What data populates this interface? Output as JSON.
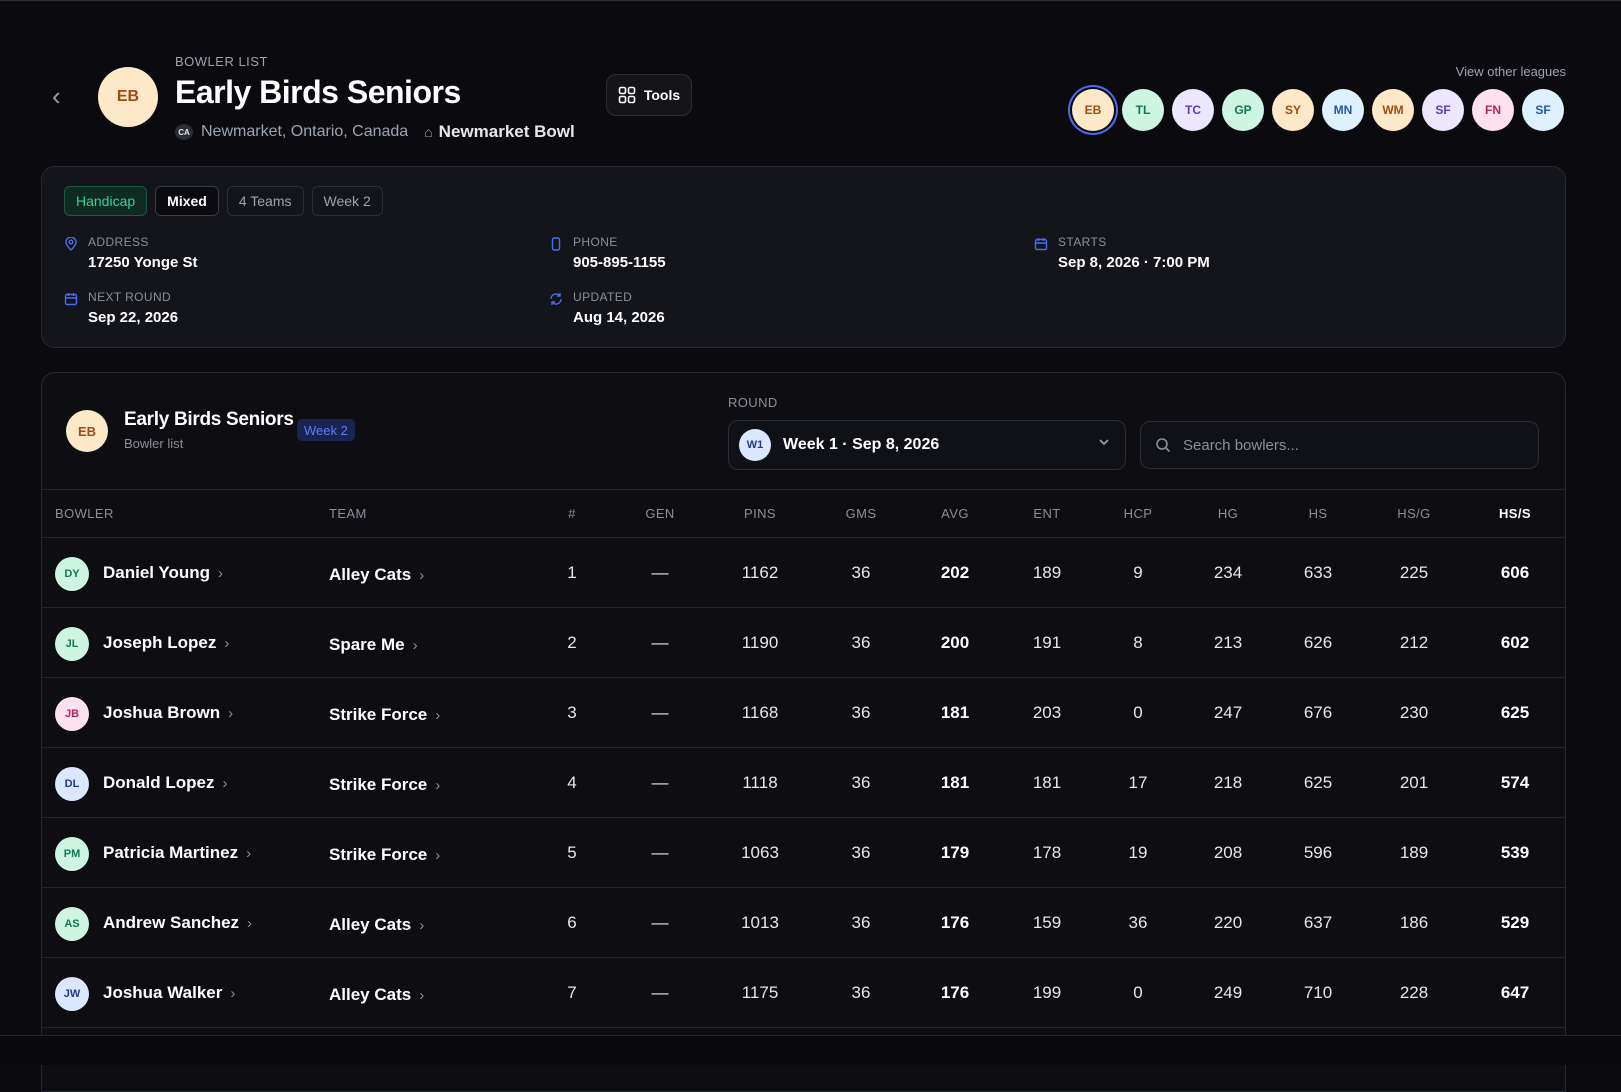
{
  "header": {
    "eyebrow": "BOWLER LIST",
    "title": "Early Birds Seniors",
    "logo": "EB",
    "country_code": "CA",
    "location": "Newmarket, Ontario, Canada",
    "center": "Newmarket Bowl",
    "tools_label": "Tools",
    "view_other": "View other leagues"
  },
  "leagues": [
    {
      "code": "EB",
      "bg": "#fde9c8",
      "fg": "#a34a14",
      "active": true
    },
    {
      "code": "TL",
      "bg": "#cdf5e2",
      "fg": "#0f7a4f"
    },
    {
      "code": "TC",
      "bg": "#ece6ff",
      "fg": "#5b3bb0"
    },
    {
      "code": "GP",
      "bg": "#cdf5e2",
      "fg": "#0f7a4f"
    },
    {
      "code": "SY",
      "bg": "#fde9c8",
      "fg": "#a34a14"
    },
    {
      "code": "MN",
      "bg": "#dff0ff",
      "fg": "#1e5aa8"
    },
    {
      "code": "WM",
      "bg": "#fde9c8",
      "fg": "#a34a14"
    },
    {
      "code": "SF",
      "bg": "#ece6ff",
      "fg": "#5b3bb0"
    },
    {
      "code": "FN",
      "bg": "#ffe1ee",
      "fg": "#b0275f"
    },
    {
      "code": "SF",
      "bg": "#dff0ff",
      "fg": "#1e5aa8"
    }
  ],
  "info": {
    "chips": [
      "Handicap",
      "Mixed",
      "4 Teams",
      "Week 2"
    ],
    "address_label": "ADDRESS",
    "address": "17250 Yonge St",
    "phone_label": "PHONE",
    "phone": "905-895-1155",
    "starts_label": "STARTS",
    "starts": "Sep 8, 2026 · 7:00 PM",
    "next_label": "NEXT ROUND",
    "next": "Sep 22, 2026",
    "updated_label": "UPDATED",
    "updated": "Aug 14, 2026"
  },
  "panel": {
    "logo": "EB",
    "title": "Early Birds Seniors",
    "subtitle": "Bowler list",
    "week_badge": "Week 2",
    "round_label": "ROUND",
    "round_code": "W1",
    "round_value": "Week 1 · Sep 8, 2026",
    "search_placeholder": "Search bowlers..."
  },
  "columns": [
    "BOWLER",
    "TEAM",
    "#",
    "GEN",
    "PINS",
    "GMS",
    "AVG",
    "ENT",
    "HCP",
    "HG",
    "HS",
    "HS/G",
    "HS/S"
  ],
  "rows": [
    {
      "ini": "DY",
      "name": "Daniel Young",
      "team": "Alley Cats",
      "num": "1",
      "gen": "—",
      "pins": "1162",
      "gms": "36",
      "avg": "202",
      "ent": "189",
      "hcp": "9",
      "hg": "234",
      "hs": "633",
      "hsg": "225",
      "hss": "606",
      "bg": "#cdf5e2",
      "fg": "#0f7a4f"
    },
    {
      "ini": "JL",
      "name": "Joseph Lopez",
      "team": "Spare Me",
      "num": "2",
      "gen": "—",
      "pins": "1190",
      "gms": "36",
      "avg": "200",
      "ent": "191",
      "hcp": "8",
      "hg": "213",
      "hs": "626",
      "hsg": "212",
      "hss": "602",
      "bg": "#cdf5e2",
      "fg": "#0f7a4f"
    },
    {
      "ini": "JB",
      "name": "Joshua Brown",
      "team": "Strike Force",
      "num": "3",
      "gen": "—",
      "pins": "1168",
      "gms": "36",
      "avg": "181",
      "ent": "203",
      "hcp": "0",
      "hg": "247",
      "hs": "676",
      "hsg": "230",
      "hss": "625",
      "bg": "#ffe1ee",
      "fg": "#b0275f"
    },
    {
      "ini": "DL",
      "name": "Donald Lopez",
      "team": "Strike Force",
      "num": "4",
      "gen": "—",
      "pins": "1118",
      "gms": "36",
      "avg": "181",
      "ent": "181",
      "hcp": "17",
      "hg": "218",
      "hs": "625",
      "hsg": "201",
      "hss": "574",
      "bg": "#dbe6ff",
      "fg": "#1e3a8a"
    },
    {
      "ini": "PM",
      "name": "Patricia Martinez",
      "team": "Strike Force",
      "num": "5",
      "gen": "—",
      "pins": "1063",
      "gms": "36",
      "avg": "179",
      "ent": "178",
      "hcp": "19",
      "hg": "208",
      "hs": "596",
      "hsg": "189",
      "hss": "539",
      "bg": "#cdf5e2",
      "fg": "#0f7a4f"
    },
    {
      "ini": "AS",
      "name": "Andrew Sanchez",
      "team": "Alley Cats",
      "num": "6",
      "gen": "—",
      "pins": "1013",
      "gms": "36",
      "avg": "176",
      "ent": "159",
      "hcp": "36",
      "hg": "220",
      "hs": "637",
      "hsg": "186",
      "hss": "529",
      "bg": "#cdf5e2",
      "fg": "#0f7a4f"
    },
    {
      "ini": "JW",
      "name": "Joshua Walker",
      "team": "Alley Cats",
      "num": "7",
      "gen": "—",
      "pins": "1175",
      "gms": "36",
      "avg": "176",
      "ent": "199",
      "hcp": "0",
      "hg": "249",
      "hs": "710",
      "hsg": "228",
      "hss": "647",
      "bg": "#dbe6ff",
      "fg": "#1e3a8a"
    }
  ]
}
